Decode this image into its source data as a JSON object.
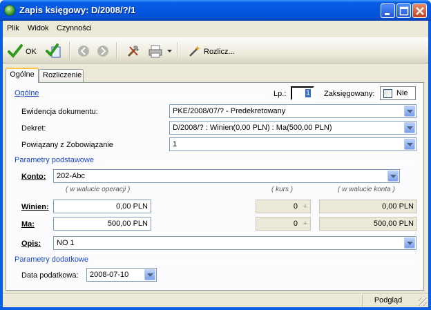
{
  "window": {
    "title": "Zapis księgowy: D/2008/?/1"
  },
  "menu": [
    "Plik",
    "Widok",
    "Czynności"
  ],
  "toolbar": {
    "ok_label": "OK",
    "rozlicz_label": "Rozlicz..."
  },
  "tabs": [
    {
      "label": "Ogólne",
      "active": true
    },
    {
      "label": "Rozliczenie",
      "active": false
    }
  ],
  "general": {
    "section_label": "Ogólne",
    "lp_label": "Lp.:",
    "lp_value": "1",
    "zaksiegowany_label": "Zaksięgowany:",
    "zaksiegowany_value": "Nie",
    "ewidencja_label": "Ewidencja dokumentu:",
    "ewidencja_value": "PKE/2008/07/? - Predekretowany",
    "dekret_label": "Dekret:",
    "dekret_value": "D/2008/? : Winien(0,00 PLN) : Ma(500,00 PLN)",
    "powiazany_label": "Powiązany z",
    "powiazany_type": "Zobowiązanie",
    "powiazany_value": "1"
  },
  "basic": {
    "section_label": "Parametry podstawowe",
    "konto_label": "Konto:",
    "konto_value": "202-Abc",
    "hint_operation": "( w walucie operacji )",
    "hint_rate": "( kurs )",
    "hint_account": "( w walucie konta )",
    "winien_label": "Winien:",
    "winien_value": "0,00 PLN",
    "winien_rate": "0",
    "winien_account": "0,00 PLN",
    "ma_label": "Ma:",
    "ma_value": "500,00 PLN",
    "ma_rate": "0",
    "ma_account": "500,00 PLN",
    "opis_label": "Opis:",
    "opis_value": "NO 1"
  },
  "extra": {
    "section_label": "Parametry dodatkowe",
    "data_label": "Data podatkowa:",
    "data_value": "2008-07-10"
  },
  "status": {
    "mode": "Podgląd"
  },
  "colors": {
    "section": "#1a48c4",
    "title_bar": "#0456e0",
    "face": "#ece9d8"
  }
}
